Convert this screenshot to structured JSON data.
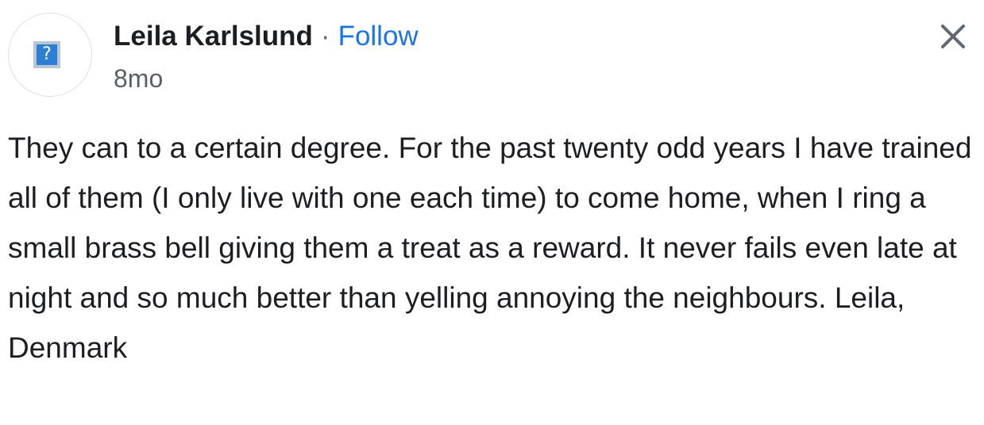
{
  "comment": {
    "author": {
      "name": "Leila Karlslund",
      "avatar_icon": "missing-image-icon",
      "avatar_glyph": "?"
    },
    "separator": "·",
    "follow_label": "Follow",
    "timestamp": "8mo",
    "close_icon": "close-icon",
    "body": "They can to a certain degree. For the past twenty odd years I have trained all of them (I only live with one each time) to come home, when I ring a small brass bell giving them a treat as a reward. It never fails even late at night and so much better than yelling annoying the neighbours. Leila, Denmark"
  },
  "colors": {
    "link": "#1a73e8",
    "text": "#1c1e21",
    "muted": "#5b5e63",
    "close_icon": "#606770"
  }
}
